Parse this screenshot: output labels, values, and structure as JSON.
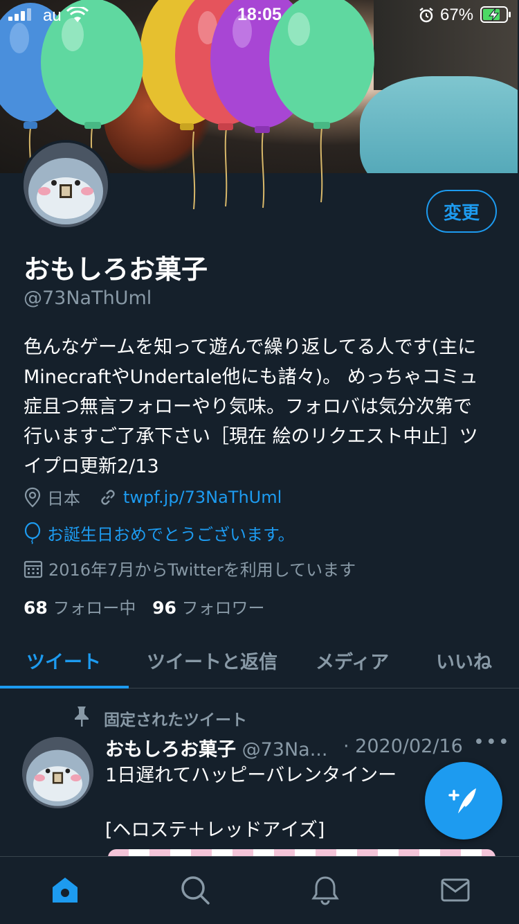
{
  "status_bar": {
    "carrier": "au",
    "time": "18:05",
    "battery_percent": "67%"
  },
  "profile": {
    "edit_label": "変更",
    "name": "おもしろお菓子",
    "handle": "@73NaThUml",
    "bio_lines": [
      "色んなゲームを知って遊んで繰り返してる人です(主に",
      "MinecraftやUndertale他にも諸々)。 めっちゃコミュ",
      "症且つ無言フォローやり気味。フォロバは気分次第で",
      "行いますご了承下さい［現在 絵のリクエスト中止］ツ",
      "イプロ更新2/13"
    ],
    "location": "日本",
    "website": "twpf.jp/73NaThUml",
    "birthday": "お誕生日おめでとうございます。",
    "joined": "2016年7月からTwitterを利用しています",
    "following_count": "68",
    "following_label": "フォロー中",
    "followers_count": "96",
    "followers_label": "フォロワー"
  },
  "tabs": [
    {
      "label": "ツイート",
      "active": true
    },
    {
      "label": "ツイートと返信",
      "active": false
    },
    {
      "label": "メディア",
      "active": false
    },
    {
      "label": "いいね",
      "active": false
    }
  ],
  "pinned_tweet": {
    "pinned_label": "固定されたツイート",
    "author_name": "おもしろお菓子",
    "author_handle": "@73Na...",
    "date": "· 2020/02/16",
    "more": "•••",
    "text_line1": "1日遅れてハッピーバレンタインー",
    "text_line2": "[ヘロステ＋レッドアイズ]"
  },
  "icons": {
    "compose": "compose-tweet-icon",
    "home": "home-icon",
    "search": "search-icon",
    "notifications": "bell-icon",
    "messages": "mail-icon"
  },
  "colors": {
    "background": "#15202b",
    "accent": "#1d9bf0",
    "secondary_text": "#8899a6",
    "divider": "#38444d"
  }
}
